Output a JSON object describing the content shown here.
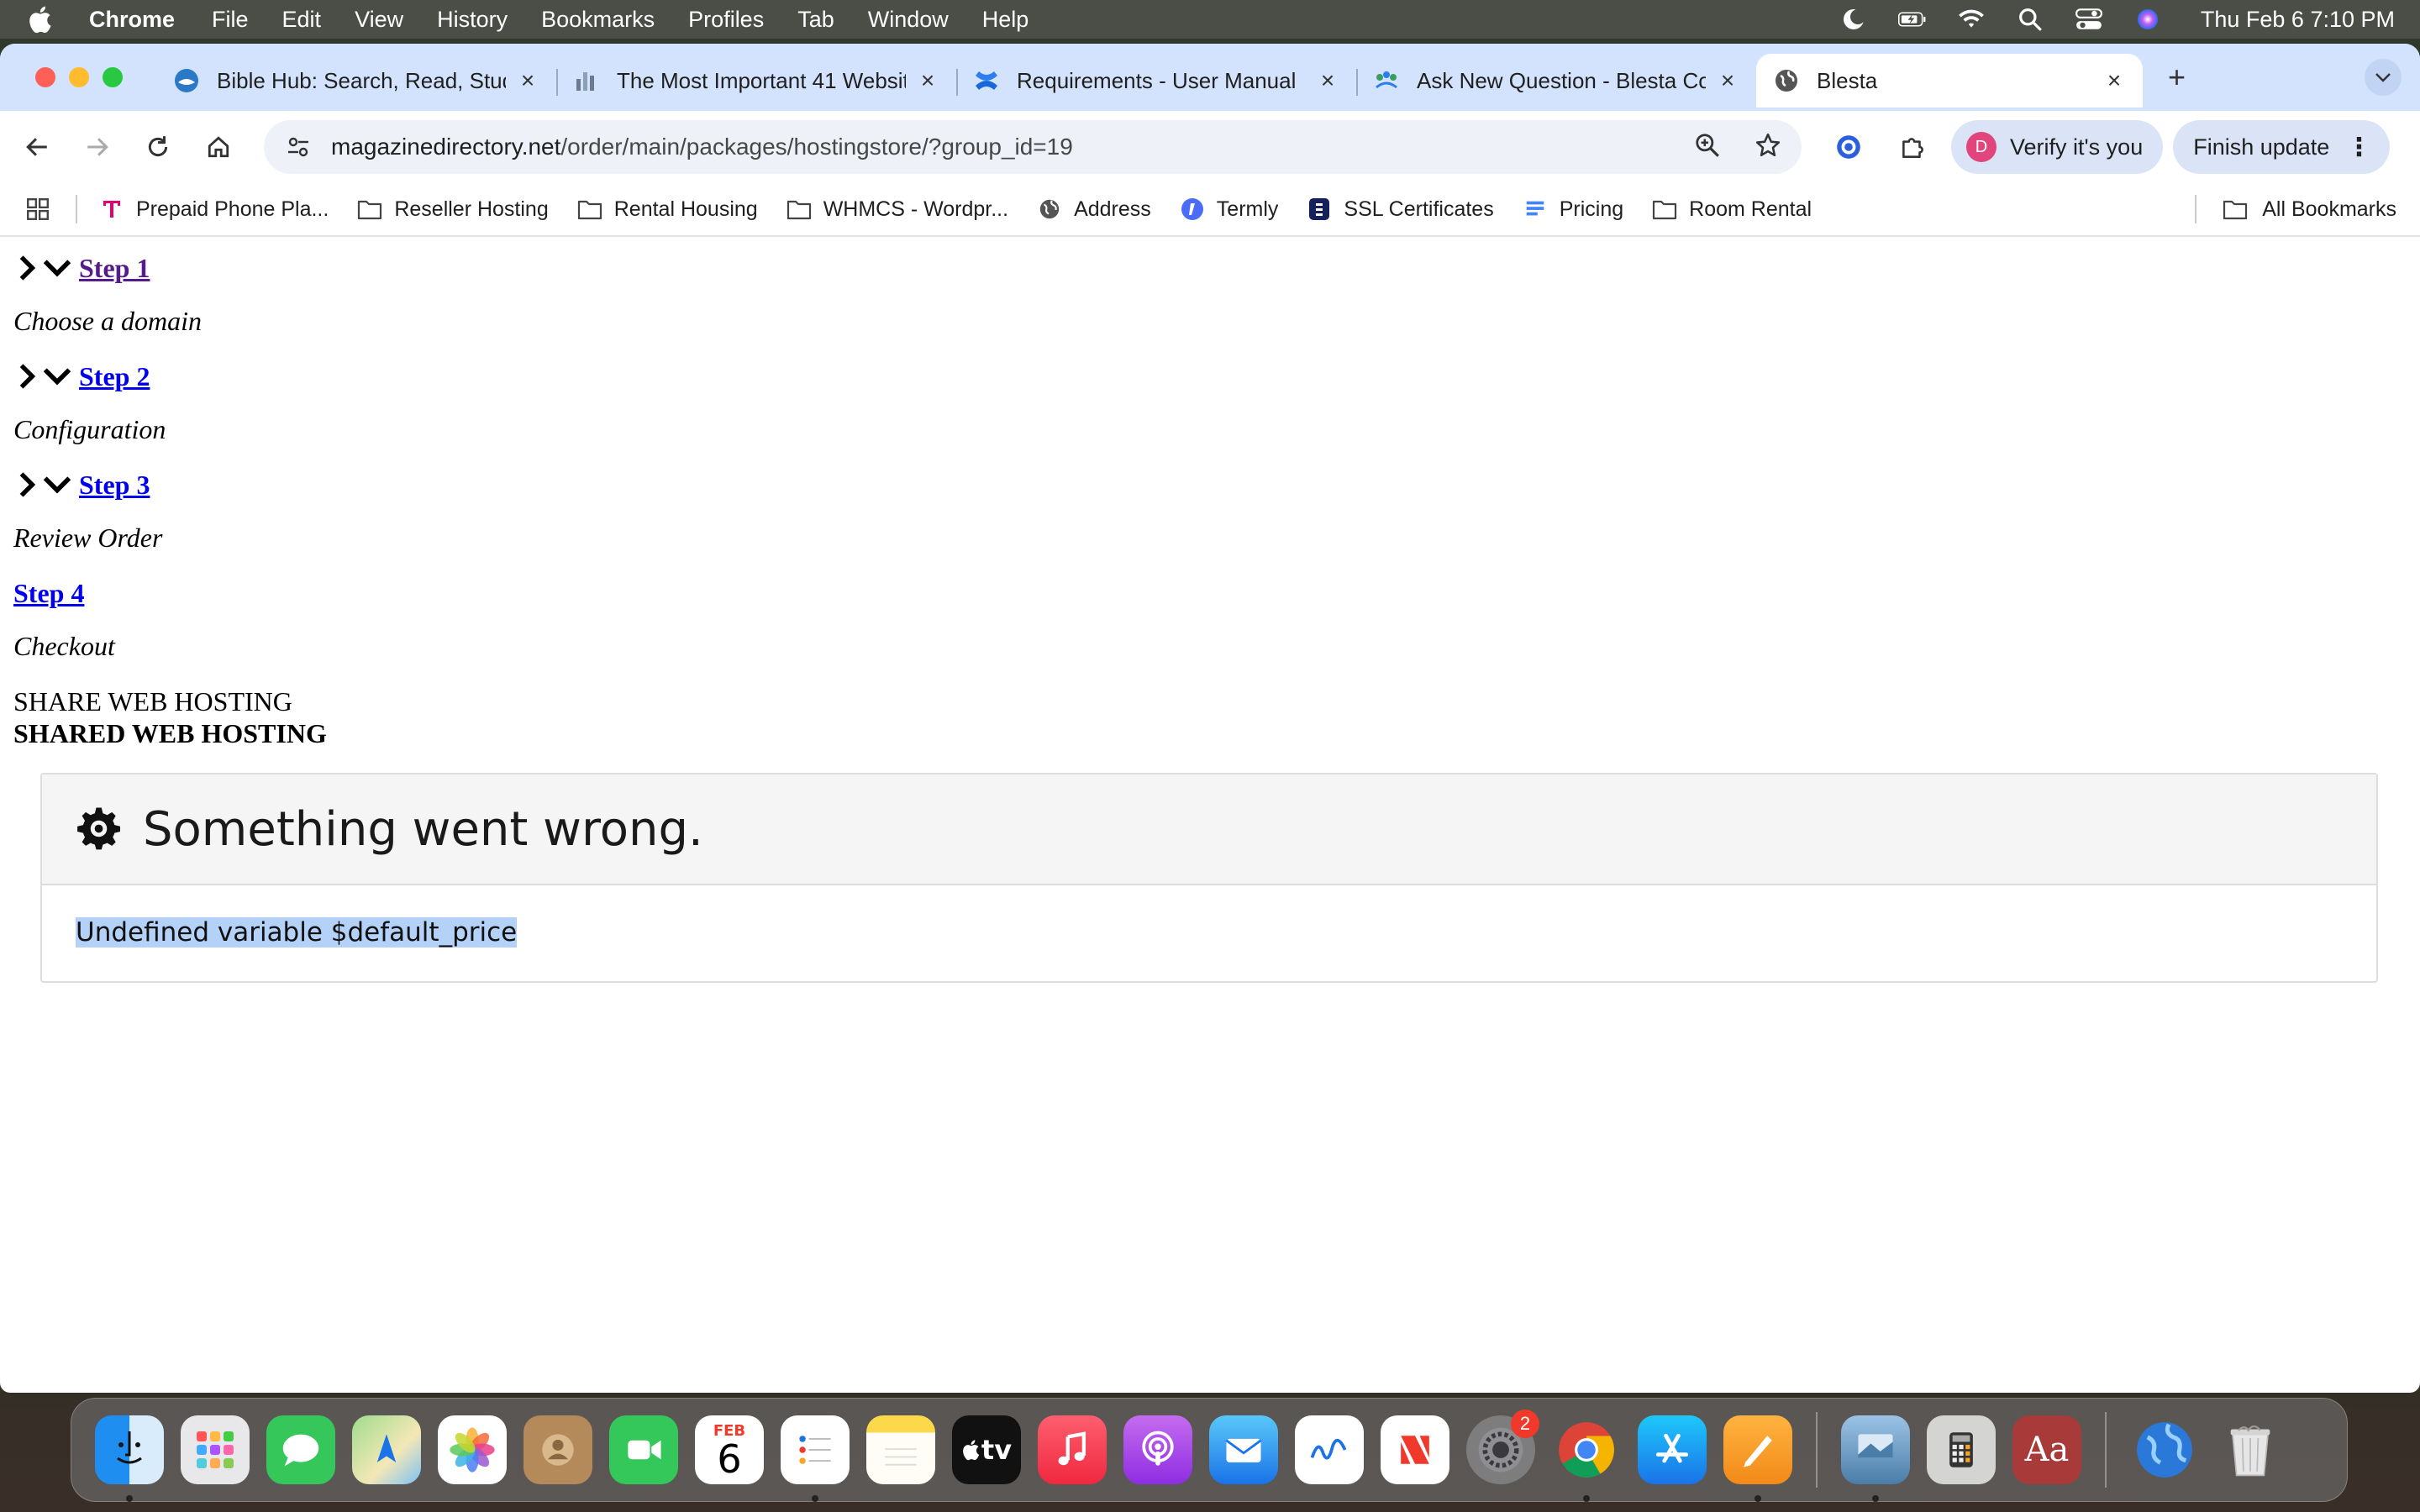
{
  "menubar": {
    "app_name": "Chrome",
    "items": [
      "File",
      "Edit",
      "View",
      "History",
      "Bookmarks",
      "Profiles",
      "Tab",
      "Window",
      "Help"
    ],
    "clock": "Thu Feb 6  7:10 PM"
  },
  "tabs": [
    {
      "title": "Bible Hub: Search, Read, Study",
      "icon": "bible-hub-icon"
    },
    {
      "title": "The Most Important 41 Websites",
      "icon": "chart-icon"
    },
    {
      "title": "Requirements - User Manual",
      "icon": "confluence-icon"
    },
    {
      "title": "Ask New Question - Blesta Co",
      "icon": "community-icon"
    },
    {
      "title": "Blesta",
      "icon": "globe-icon",
      "active": true
    }
  ],
  "address_bar": {
    "host": "magazinedirectory.net",
    "path": "/order/main/packages/hostingstore/?group_id=19"
  },
  "profile": {
    "initial": "D",
    "verify_label": "Verify it's you",
    "finish_label": "Finish update"
  },
  "bookmarks": [
    {
      "label": "Prepaid Phone Pla...",
      "icon": "t-mobile-icon"
    },
    {
      "label": "Reseller Hosting",
      "icon": "folder-icon"
    },
    {
      "label": "Rental Housing",
      "icon": "folder-icon"
    },
    {
      "label": "WHMCS - Wordpr...",
      "icon": "folder-icon"
    },
    {
      "label": "Address",
      "icon": "globe-icon"
    },
    {
      "label": "Termly",
      "icon": "termly-icon"
    },
    {
      "label": "SSL Certificates",
      "icon": "ssl-icon"
    },
    {
      "label": "Pricing",
      "icon": "docs-icon"
    },
    {
      "label": "Room Rental",
      "icon": "folder-icon"
    }
  ],
  "all_bookmarks_label": "All Bookmarks",
  "steps": [
    {
      "label": "Step 1",
      "desc": "Choose a domain"
    },
    {
      "label": "Step 2",
      "desc": "Configuration"
    },
    {
      "label": "Step 3",
      "desc": "Review Order"
    },
    {
      "label": "Step 4",
      "desc": "Checkout"
    }
  ],
  "group": {
    "title": "SHARE WEB HOSTING",
    "title_bold": "SHARED WEB HOSTING"
  },
  "error": {
    "heading": "Something went wrong.",
    "message": "Undefined variable $default_price"
  },
  "dock": {
    "calendar_month": "FEB",
    "calendar_day": "6",
    "settings_badge": "2",
    "tv_label": "tv",
    "dictionary_label": "Aa"
  },
  "colors": {
    "link": "#0000ee",
    "link_visited": "#551a8b",
    "selection": "#b4d2f7",
    "tabstrip": "#d3e3fd"
  }
}
